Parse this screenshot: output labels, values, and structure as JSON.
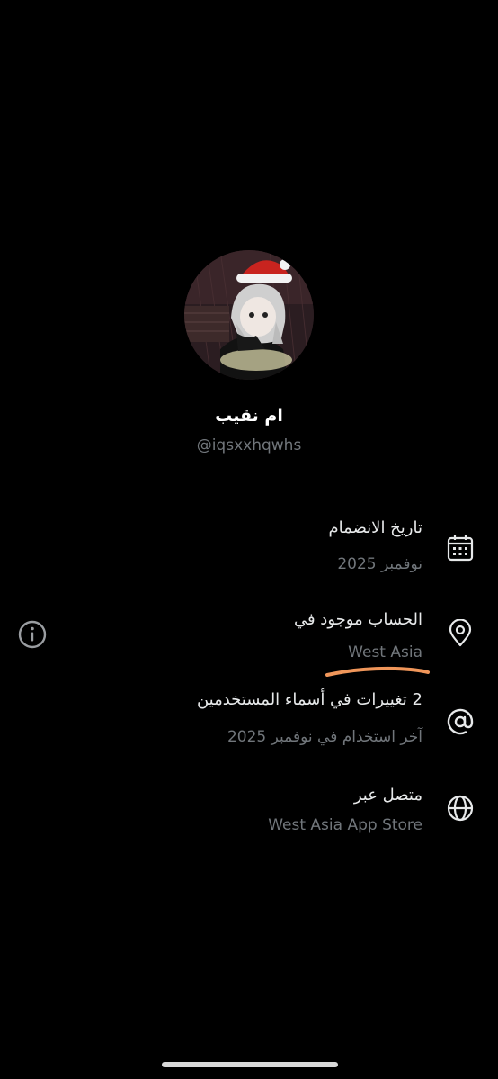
{
  "profile": {
    "name": "ام نقيب",
    "handle": "@iqsxxhqwhs"
  },
  "rows": [
    {
      "icon": "calendar-icon",
      "title": "تاريخ الانضمام",
      "subtitle": "نوفمبر 2025"
    },
    {
      "icon": "location-pin-icon",
      "title": "الحساب موجود في",
      "subtitle": "West Asia"
    },
    {
      "icon": "at-sign-icon",
      "title": "2 تغييرات في أسماء المستخدمين",
      "subtitle": "آخر استخدام في نوفمبر 2025"
    },
    {
      "icon": "globe-icon",
      "title": "متصل عبر",
      "subtitle": "West Asia App Store"
    }
  ],
  "info_icon": "info-icon",
  "colors": {
    "background": "#000000",
    "text": "#e7e9ea",
    "muted": "#71767b",
    "highlight": "#f0965a"
  }
}
